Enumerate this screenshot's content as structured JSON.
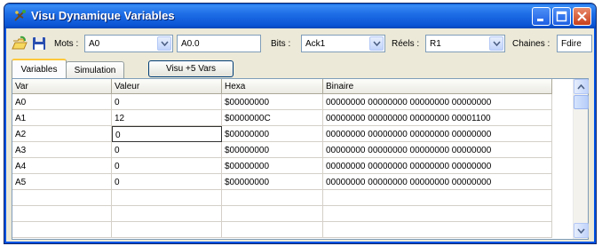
{
  "window": {
    "title": "Visu Dynamique Variables"
  },
  "toolbar": {
    "mots_label": "Mots :",
    "mots_value": "A0",
    "mots_text": "A0.0",
    "bits_label": "Bits :",
    "bits_value": "Ack1",
    "reels_label": "Réels :",
    "reels_value": "R1",
    "chaines_label": "Chaines :",
    "chaines_value": "Fdire"
  },
  "tabs": [
    {
      "label": "Variables",
      "active": true
    },
    {
      "label": "Simulation",
      "active": false
    }
  ],
  "visu_button": "Visu +5 Vars",
  "table": {
    "columns": [
      "Var",
      "Valeur",
      "Hexa",
      "Binaire"
    ],
    "rows": [
      [
        "A0",
        "0",
        "$00000000",
        "00000000 00000000 00000000 00000000"
      ],
      [
        "A1",
        "12",
        "$0000000C",
        "00000000 00000000 00000000 00001100"
      ],
      [
        "A2",
        "0",
        "$00000000",
        "00000000 00000000 00000000 00000000"
      ],
      [
        "A3",
        "0",
        "$00000000",
        "00000000 00000000 00000000 00000000"
      ],
      [
        "A4",
        "0",
        "$00000000",
        "00000000 00000000 00000000 00000000"
      ],
      [
        "A5",
        "0",
        "$00000000",
        "00000000 00000000 00000000 00000000"
      ]
    ]
  },
  "colors": {
    "titlebar": "#0a55d4",
    "window_bg": "#ece9d8",
    "close_button": "#c8401c",
    "active_tab_accent": "#ffc83c"
  },
  "icons": [
    "app-icon",
    "open-folder-icon",
    "save-disk-icon",
    "chevron-down-icon",
    "chevron-up-icon",
    "minimize-icon",
    "maximize-icon",
    "close-icon"
  ]
}
